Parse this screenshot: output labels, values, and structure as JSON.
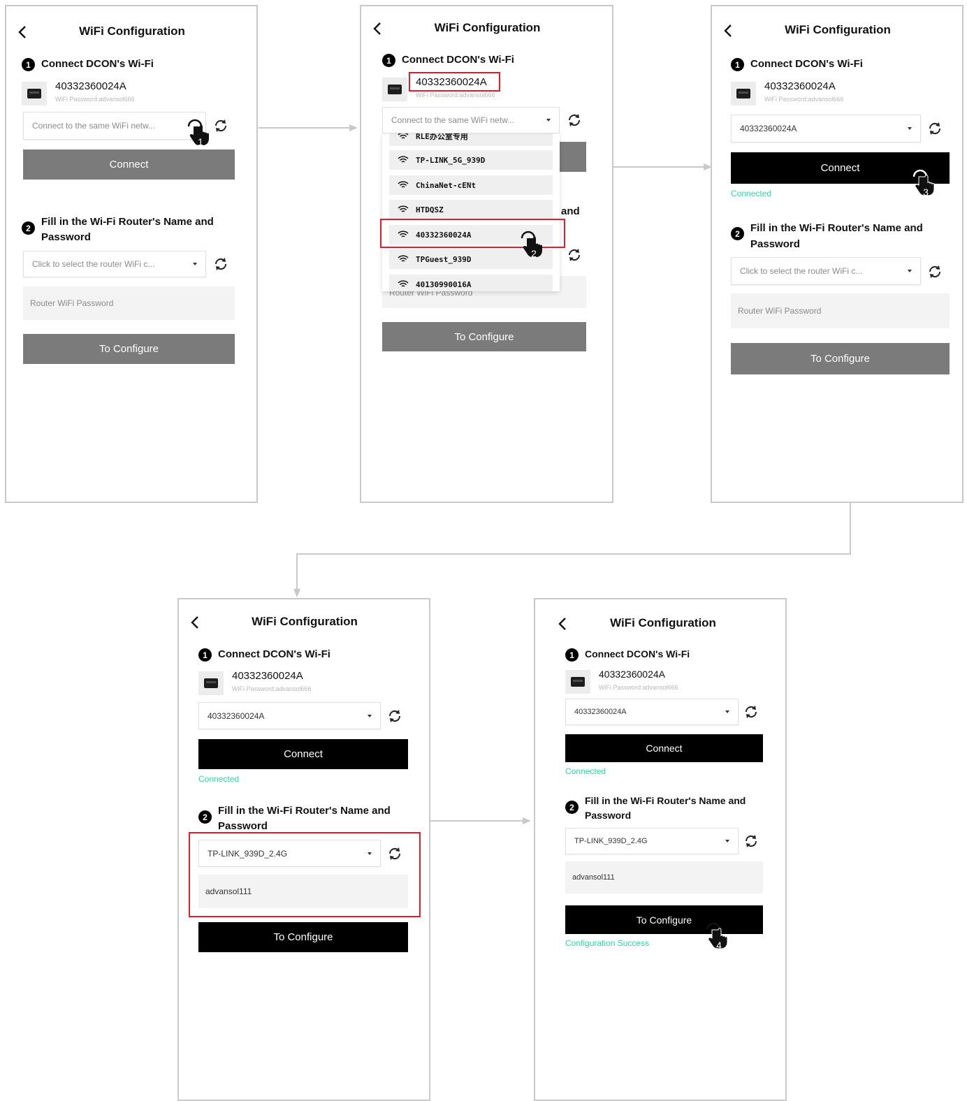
{
  "app": {
    "title": "WiFi Configuration",
    "step1_label": "Connect DCON's Wi-Fi",
    "step2_label": "Fill in the Wi-Fi Router's Name and Password",
    "device_id": "40332360024A",
    "device_password_hint": "WiFi Password:advansol666",
    "connect_placeholder": "Connect to the same WiFi netw...",
    "router_placeholder": "Click to select the router WiFi c...",
    "router_password_placeholder": "Router WiFi Password",
    "connect_label": "Connect",
    "configure_label": "To Configure",
    "connected_status": "Connected",
    "success_status": "Configuration Success",
    "selected_network": "40332360024A",
    "selected_router": "TP-LINK_939D_2.4G",
    "router_password_value": "advansol111",
    "step1_number": "1",
    "step2_number": "2"
  },
  "dropdown": {
    "items": [
      "RLE办公室专用",
      "TP-LINK_5G_939D",
      "ChinaNet-cENt",
      "HTDQSZ",
      "40332360024A",
      "TPGuest_939D",
      "40130990016A"
    ],
    "partial_text": "and"
  },
  "markers": {
    "step_1": "1",
    "step_2": "2",
    "step_3": "3",
    "step_4": "4"
  },
  "colors": {
    "button_inactive": "#7b7b7b",
    "button_active": "#000000",
    "status_green": "#25e0a0",
    "highlight_red": "#e11d2b"
  }
}
